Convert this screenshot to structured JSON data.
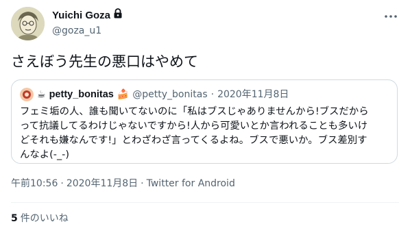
{
  "author": {
    "display_name": "Yuichi Goza",
    "handle": "@goza_u1",
    "protected_icon": "lock-icon"
  },
  "tweet": {
    "text": "さえぼう先生の悪口はやめて"
  },
  "quoted": {
    "emoji_prefix": "☕",
    "display_name": "petty_bonitas",
    "emoji_suffix": "🍰",
    "handle": "@petty_bonitas",
    "separator": "·",
    "date": "2020年11月8日",
    "text_lines": [
      "フェミ垢の人、誰も聞いてないのに「私はブスじゃありませんから!ブスだから",
      "って抗議してるわけじゃないですから!人から可愛いとか言われることも多いけ",
      "どそれも嫌なんです!」とわざわざ言ってくるよね。ブスで悪いか。ブス差別す",
      "んなよ(-_-)"
    ]
  },
  "meta": {
    "time": "午前10:56",
    "sep1": "·",
    "date": "2020年11月8日",
    "sep2": "·",
    "source": "Twitter for Android"
  },
  "likes": {
    "count": "5",
    "label": "件のいいね"
  },
  "colors": {
    "text": "#0f1419",
    "secondary": "#536471",
    "border": "#cfd9de"
  }
}
